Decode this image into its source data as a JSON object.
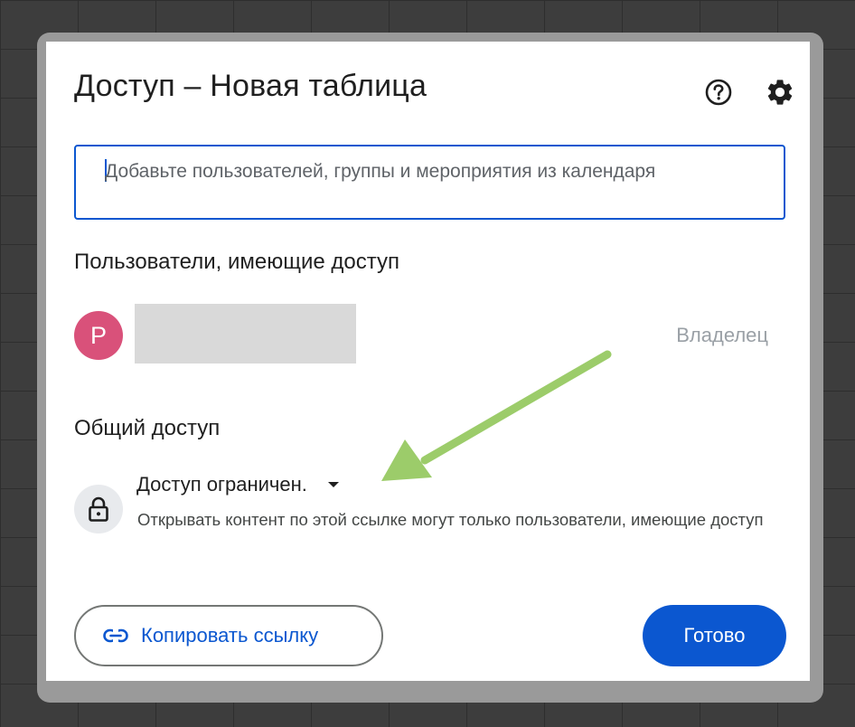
{
  "dialog": {
    "title": "Доступ – Новая таблица",
    "help_icon": "help-circle-icon",
    "settings_icon": "gear-icon"
  },
  "add_people": {
    "placeholder": "Добавьте пользователей, группы и мероприятия из календаря"
  },
  "people_section": {
    "heading": "Пользователи, имеющие доступ",
    "owner": {
      "avatar_letter": "P",
      "avatar_color": "#d9517a",
      "role": "Владелец"
    }
  },
  "general_access": {
    "heading": "Общий доступ",
    "lock_icon": "lock-icon",
    "selected_value": "Доступ ограничен.",
    "description": "Открывать контент по этой ссылке могут только пользователи, имеющие доступ"
  },
  "footer": {
    "copy_link_label": "Копировать ссылку",
    "done_label": "Готово"
  },
  "colors": {
    "accent": "#0b57d0",
    "annotation_arrow": "#9ccc6a"
  }
}
